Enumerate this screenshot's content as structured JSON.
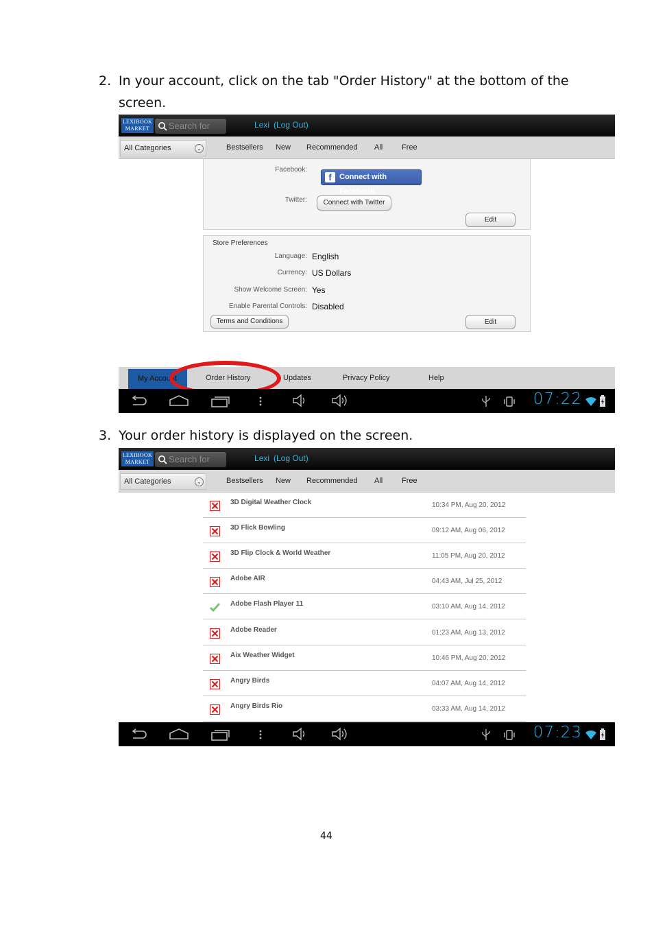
{
  "step2": {
    "number": "2.",
    "text": "In your account, click on the tab \"Order History\" at the bottom of the screen."
  },
  "step3": {
    "number": "3.",
    "text": "Your order history is displayed on the screen."
  },
  "app": {
    "logo_line1": "LEXIBOOK",
    "logo_line2": "MARKET",
    "search_placeholder": "Search for",
    "user_name": "Lexi",
    "logout": "(Log Out)",
    "category_select": "All Categories",
    "categories": [
      "Bestsellers",
      "New",
      "Recommended",
      "All",
      "Free"
    ],
    "accent_color": "#33b5e5"
  },
  "screen1": {
    "facebook_label": "Facebook:",
    "facebook_button": "Connect with Facebook",
    "twitter_label": "Twitter:",
    "twitter_button": "Connect with Twitter",
    "edit_button": "Edit",
    "store_prefs_title": "Store Preferences",
    "prefs": [
      {
        "label": "Language:",
        "value": "English"
      },
      {
        "label": "Currency:",
        "value": "US Dollars"
      },
      {
        "label": "Show Welcome Screen:",
        "value": "Yes"
      },
      {
        "label": "Enable Parental Controls:",
        "value": "Disabled"
      }
    ],
    "terms_button": "Terms and Conditions",
    "edit_button2": "Edit",
    "tabs": {
      "my_account": "My Account",
      "order_history": "Order History",
      "updates": "Updates",
      "privacy_policy": "Privacy Policy",
      "help": "Help"
    },
    "clock": "07:22"
  },
  "screen2": {
    "orders": [
      {
        "name": "3D Digital Weather Clock",
        "date": "10:34 PM, Aug 20, 2012",
        "status": "failed"
      },
      {
        "name": "3D Flick Bowling",
        "date": "09:12 AM, Aug 06, 2012",
        "status": "failed"
      },
      {
        "name": "3D Flip Clock & World Weather",
        "date": "11:05 PM, Aug 20, 2012",
        "status": "failed"
      },
      {
        "name": "Adobe AIR",
        "date": "04:43 AM, Jul 25, 2012",
        "status": "failed"
      },
      {
        "name": "Adobe Flash Player 11",
        "date": "03:10 AM, Aug 14, 2012",
        "status": "installed"
      },
      {
        "name": "Adobe Reader",
        "date": "01:23 AM, Aug 13, 2012",
        "status": "failed"
      },
      {
        "name": "Aix Weather Widget",
        "date": "10:46 PM, Aug 20, 2012",
        "status": "failed"
      },
      {
        "name": "Angry Birds",
        "date": "04:07 AM, Aug 14, 2012",
        "status": "failed"
      },
      {
        "name": "Angry Birds Rio",
        "date": "03:33 AM, Aug 14, 2012",
        "status": "failed"
      }
    ],
    "clock": "07:23"
  },
  "page_number": "44"
}
